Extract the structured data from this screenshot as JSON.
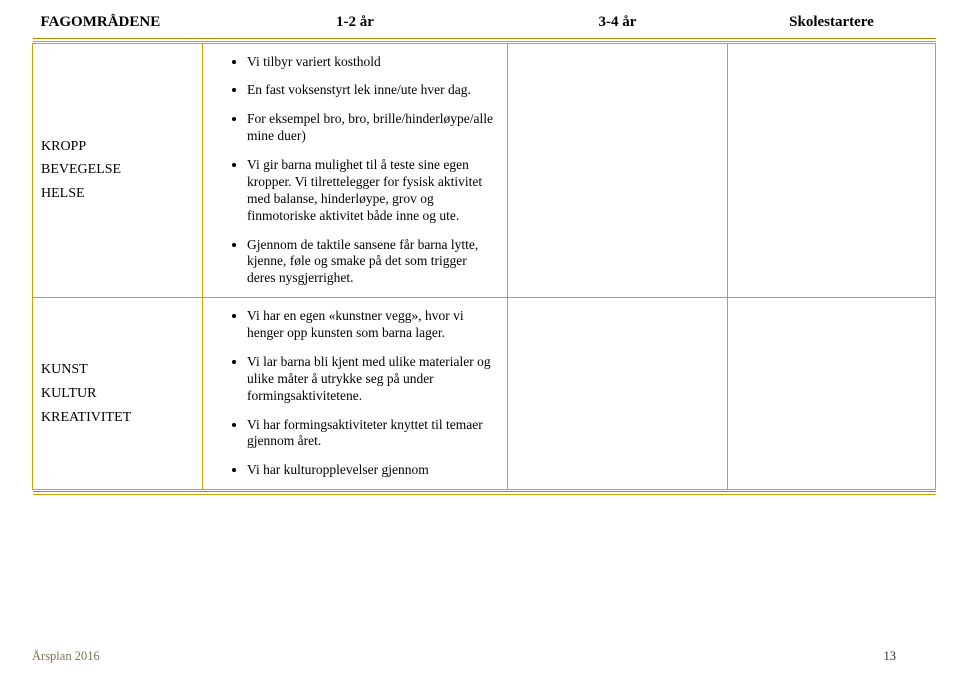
{
  "header": {
    "col1": "FAGOMRÅDENE",
    "col2": "1-2 år",
    "col3": "3-4 år",
    "col4": "Skolestartere"
  },
  "row1": {
    "label1": "KROPP",
    "label2": "BEVEGELSE",
    "label3": "HELSE",
    "bullets": {
      "b1": "Vi tilbyr variert kosthold",
      "b2": "En fast voksenstyrt lek inne/ute hver dag.",
      "b3": "For eksempel bro, bro, brille/hinderløype/alle mine duer)",
      "b4": "Vi gir barna mulighet til å teste sine egen kropper. Vi tilrettelegger for fysisk aktivitet med balanse, hinderløype, grov og finmotoriske aktivitet både inne og ute.",
      "b5": "Gjennom de taktile sansene får barna lytte, kjenne, føle og smake på det som trigger deres nysgjerrighet."
    }
  },
  "row2": {
    "label1": "KUNST",
    "label2": "KULTUR",
    "label3": "KREATIVITET",
    "bullets": {
      "b1": "Vi har en egen «kunstner vegg», hvor vi henger opp kunsten som barna lager.",
      "b2": "Vi lar barna bli kjent med ulike materialer og ulike måter å utrykke seg på under formingsaktivitetene.",
      "b3": "Vi har formingsaktiviteter knyttet til temaer gjennom året.",
      "b4": "Vi har kulturopplevelser gjennom"
    }
  },
  "footer": {
    "left": "Årsplan 2016",
    "page": "13"
  }
}
